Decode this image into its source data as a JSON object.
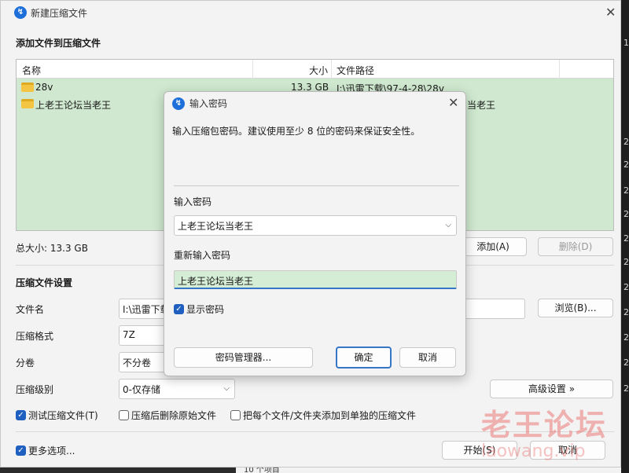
{
  "window": {
    "title": "新建压缩文件",
    "section_add": "添加文件到压缩文件",
    "columns": {
      "name": "名称",
      "size": "大小",
      "path": "文件路径"
    },
    "files": [
      {
        "name": "28v",
        "size": "13.3 GB",
        "path": "I:\\迅雷下载\\97-4-28\\28v"
      },
      {
        "name": "上老王论坛当老王",
        "size": "",
        "path": ""
      }
    ],
    "row2_path_visible": "当老王",
    "total_size": "总大小: 13.3 GB",
    "add_button": "添加(A)",
    "delete_button": "删除(D)",
    "section_settings": "压缩文件设置",
    "filename_label": "文件名",
    "filename_value": "I:\\迅雷下载",
    "browse_button": "浏览(B)...",
    "format_label": "压缩格式",
    "format_value": "7Z",
    "split_label": "分卷",
    "split_value": "不分卷",
    "level_label": "压缩级别",
    "level_value": "0-仅存储",
    "advanced_button": "高级设置 »",
    "checks": [
      {
        "label": "测试压缩文件(T)",
        "checked": true
      },
      {
        "label": "压缩后删除原始文件",
        "checked": false
      },
      {
        "label": "把每个文件/文件夹添加到单独的压缩文件",
        "checked": false
      }
    ],
    "more_options": "更多选项...",
    "more_options_checked": true,
    "start_button": "开始(S)",
    "cancel_button": "取消"
  },
  "dialog": {
    "title": "输入密码",
    "description": "输入压缩包密码。建议使用至少 8 位的密码来保证安全性。",
    "password_label": "输入密码",
    "password_value": "上老王论坛当老王",
    "reenter_label": "重新输入密码",
    "reenter_value": "上老王论坛当老王",
    "show_password_label": "显示密码",
    "show_password_checked": true,
    "manager_button": "密码管理器...",
    "ok_button": "确定",
    "cancel_button": "取消"
  },
  "background": {
    "side_numbers": [
      "1",
      "2",
      "2",
      "2",
      "2",
      "2",
      "2",
      "2",
      "2",
      "2",
      "2",
      "2"
    ],
    "bottom_text": "10 个项目"
  },
  "watermark": {
    "text": "老王论坛",
    "url": "laowang.vip"
  },
  "colors": {
    "accent": "#3576c6",
    "selection_green": "#cfe8cf",
    "app_icon": "#1e6fd9"
  }
}
